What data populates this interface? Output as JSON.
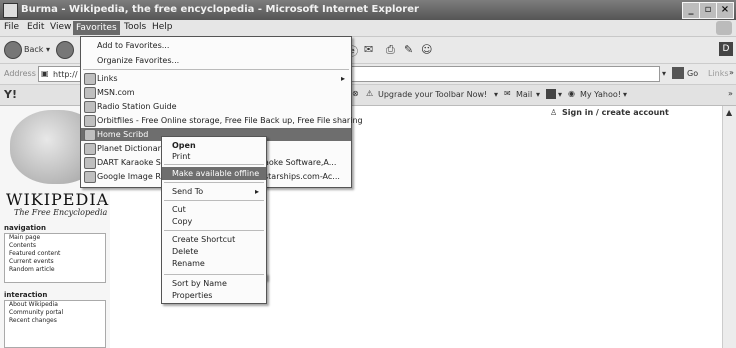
{
  "window": {
    "title": "Burma - Wikipedia, the free encyclopedia - Microsoft Internet Explorer"
  },
  "menubar": {
    "items": [
      "File",
      "Edit",
      "View",
      "Favorites",
      "Tools",
      "Help"
    ],
    "active": "Favorites"
  },
  "toolbar": {
    "back_label": "Back"
  },
  "address": {
    "label": "Address",
    "url": "http://",
    "go_label": "Go",
    "links_label": "Links"
  },
  "yahoo_toolbar": {
    "upgrade_label": "Upgrade your Toolbar Now!",
    "mail_label": "Mail",
    "my_yahoo_label": "My Yahoo!"
  },
  "favorites_menu": {
    "add_label": "Add to Favorites...",
    "organize_label": "Organize Favorites...",
    "items": [
      "Links",
      "MSN.com",
      "Radio Station Guide",
      "Orbitfiles - Free Online storage, Free File Back up, Free File sharing",
      "Home  Scribd",
      "Planet  Dictionary",
      "DART Karaoke St",
      "Google Image Res"
    ],
    "highlighted": "Home  Scribd",
    "overflow_texts": [
      "aoke Software,A...",
      "starships.com-Ac..."
    ]
  },
  "context_menu": {
    "items": [
      "Open",
      "Print",
      "Make available offline",
      "Send To",
      "Cut",
      "Copy",
      "Create Shortcut",
      "Delete",
      "Rename",
      "Sort by Name",
      "Properties"
    ],
    "bold": "Open",
    "highlighted": "Make available offline"
  },
  "wikipedia": {
    "title": "WIKIPEDIA",
    "subtitle": "The Free Encyclopedia",
    "sign_in": "Sign in / create account",
    "navigation_heading": "navigation",
    "navigation_items": [
      "Main page",
      "Contents",
      "Featured content",
      "Current events",
      "Random article"
    ],
    "interaction_heading": "interaction",
    "interaction_items": [
      "About Wikipedia",
      "Community portal",
      "Recent changes"
    ]
  },
  "colors": {
    "menu_highlight": "#6e6e6e",
    "titlebar": "#5f5f5f"
  }
}
